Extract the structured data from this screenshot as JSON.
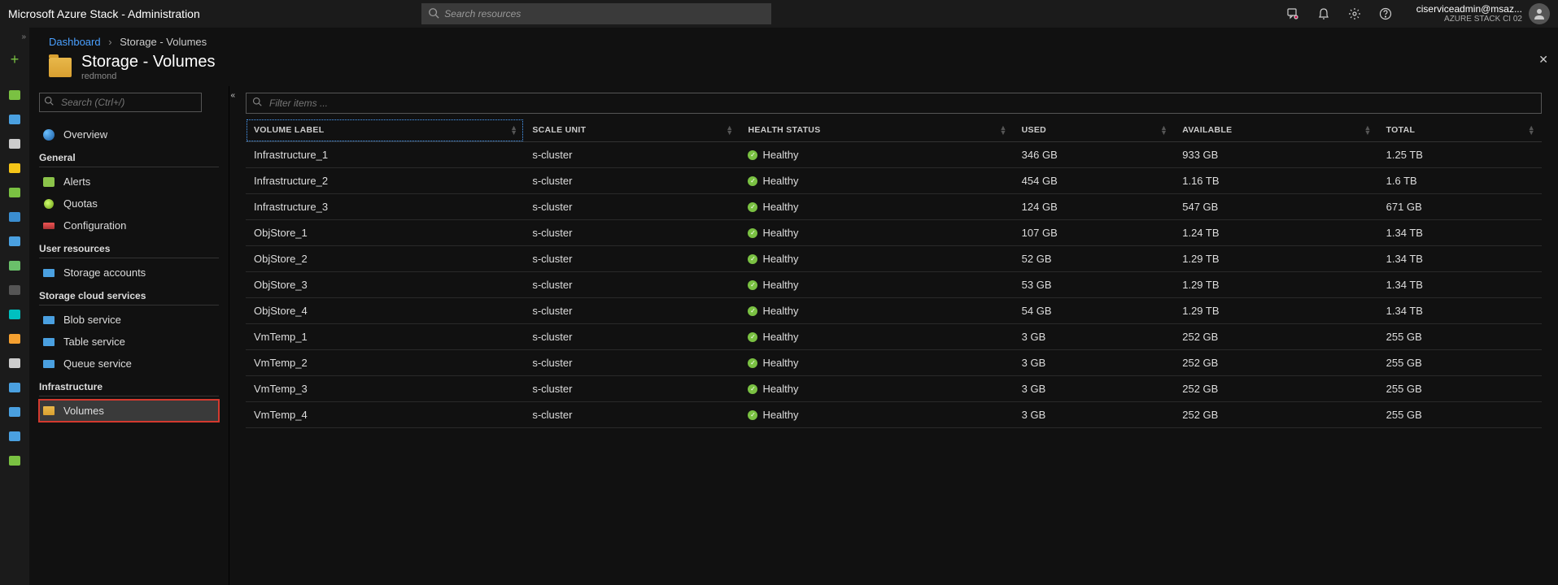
{
  "header": {
    "brand": "Microsoft Azure Stack - Administration",
    "search_placeholder": "Search resources",
    "account_email": "ciserviceadmin@msaz...",
    "account_tenant": "AZURE STACK CI 02"
  },
  "breadcrumb": {
    "root": "Dashboard",
    "current": "Storage - Volumes"
  },
  "blade": {
    "title": "Storage - Volumes",
    "subtitle": "redmond"
  },
  "sidebar": {
    "search_placeholder": "Search (Ctrl+/)",
    "overview": "Overview",
    "groups": [
      {
        "title": "General",
        "items": [
          "Alerts",
          "Quotas",
          "Configuration"
        ]
      },
      {
        "title": "User resources",
        "items": [
          "Storage accounts"
        ]
      },
      {
        "title": "Storage cloud services",
        "items": [
          "Blob service",
          "Table service",
          "Queue service"
        ]
      },
      {
        "title": "Infrastructure",
        "items": [
          "Volumes"
        ]
      }
    ]
  },
  "table": {
    "filter_placeholder": "Filter items ...",
    "columns": [
      "VOLUME LABEL",
      "SCALE UNIT",
      "HEALTH STATUS",
      "USED",
      "AVAILABLE",
      "TOTAL"
    ],
    "rows": [
      {
        "label": "Infrastructure_1",
        "scale": "s-cluster",
        "health": "Healthy",
        "used": "346 GB",
        "available": "933 GB",
        "total": "1.25 TB"
      },
      {
        "label": "Infrastructure_2",
        "scale": "s-cluster",
        "health": "Healthy",
        "used": "454 GB",
        "available": "1.16 TB",
        "total": "1.6 TB"
      },
      {
        "label": "Infrastructure_3",
        "scale": "s-cluster",
        "health": "Healthy",
        "used": "124 GB",
        "available": "547 GB",
        "total": "671 GB"
      },
      {
        "label": "ObjStore_1",
        "scale": "s-cluster",
        "health": "Healthy",
        "used": "107 GB",
        "available": "1.24 TB",
        "total": "1.34 TB"
      },
      {
        "label": "ObjStore_2",
        "scale": "s-cluster",
        "health": "Healthy",
        "used": "52 GB",
        "available": "1.29 TB",
        "total": "1.34 TB"
      },
      {
        "label": "ObjStore_3",
        "scale": "s-cluster",
        "health": "Healthy",
        "used": "53 GB",
        "available": "1.29 TB",
        "total": "1.34 TB"
      },
      {
        "label": "ObjStore_4",
        "scale": "s-cluster",
        "health": "Healthy",
        "used": "54 GB",
        "available": "1.29 TB",
        "total": "1.34 TB"
      },
      {
        "label": "VmTemp_1",
        "scale": "s-cluster",
        "health": "Healthy",
        "used": "3 GB",
        "available": "252 GB",
        "total": "255 GB"
      },
      {
        "label": "VmTemp_2",
        "scale": "s-cluster",
        "health": "Healthy",
        "used": "3 GB",
        "available": "252 GB",
        "total": "255 GB"
      },
      {
        "label": "VmTemp_3",
        "scale": "s-cluster",
        "health": "Healthy",
        "used": "3 GB",
        "available": "252 GB",
        "total": "255 GB"
      },
      {
        "label": "VmTemp_4",
        "scale": "s-cluster",
        "health": "Healthy",
        "used": "3 GB",
        "available": "252 GB",
        "total": "255 GB"
      }
    ]
  },
  "rail_colors": [
    "#7ac142",
    "#4aa0e0",
    "#ccc",
    "#f5c518",
    "#7ac142",
    "#3a8dd0",
    "#4aa0e0",
    "#6ac06a",
    "#555",
    "#00c0c0",
    "#f5a030",
    "#ccc",
    "#4aa0e0",
    "#4aa0e0",
    "#4aa0e0",
    "#7ac142"
  ]
}
